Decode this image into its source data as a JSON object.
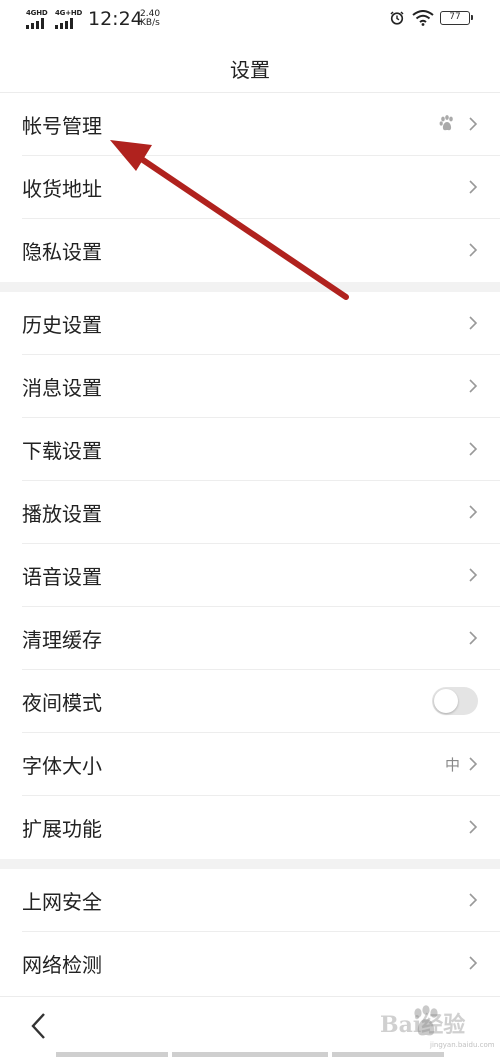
{
  "status_bar": {
    "signal1": "4GHD",
    "signal2": "4G+HD",
    "time": "12:24",
    "speed_value": "2.40",
    "speed_unit": "KB/s",
    "battery": "77"
  },
  "header": {
    "title": "设置"
  },
  "sections": [
    {
      "items": [
        {
          "name": "account",
          "label": "帐号管理",
          "icon": "paw-icon"
        },
        {
          "name": "address",
          "label": "收货地址"
        },
        {
          "name": "privacy",
          "label": "隐私设置"
        }
      ]
    },
    {
      "items": [
        {
          "name": "history",
          "label": "历史设置"
        },
        {
          "name": "message",
          "label": "消息设置"
        },
        {
          "name": "download",
          "label": "下载设置"
        },
        {
          "name": "playback",
          "label": "播放设置"
        },
        {
          "name": "voice",
          "label": "语音设置"
        },
        {
          "name": "clear-cache",
          "label": "清理缓存"
        },
        {
          "name": "night-mode",
          "label": "夜间模式",
          "toggle": false
        },
        {
          "name": "font-size",
          "label": "字体大小",
          "value": "中"
        },
        {
          "name": "extensions",
          "label": "扩展功能"
        }
      ]
    },
    {
      "items": [
        {
          "name": "web-security",
          "label": "上网安全"
        },
        {
          "name": "network-check",
          "label": "网络检测"
        }
      ]
    }
  ],
  "watermark": {
    "text": "Bai经验",
    "url": "jingyan.baidu.com"
  },
  "colors": {
    "annotation_arrow": "#b0221e",
    "section_gap": "#f2f2f2"
  }
}
